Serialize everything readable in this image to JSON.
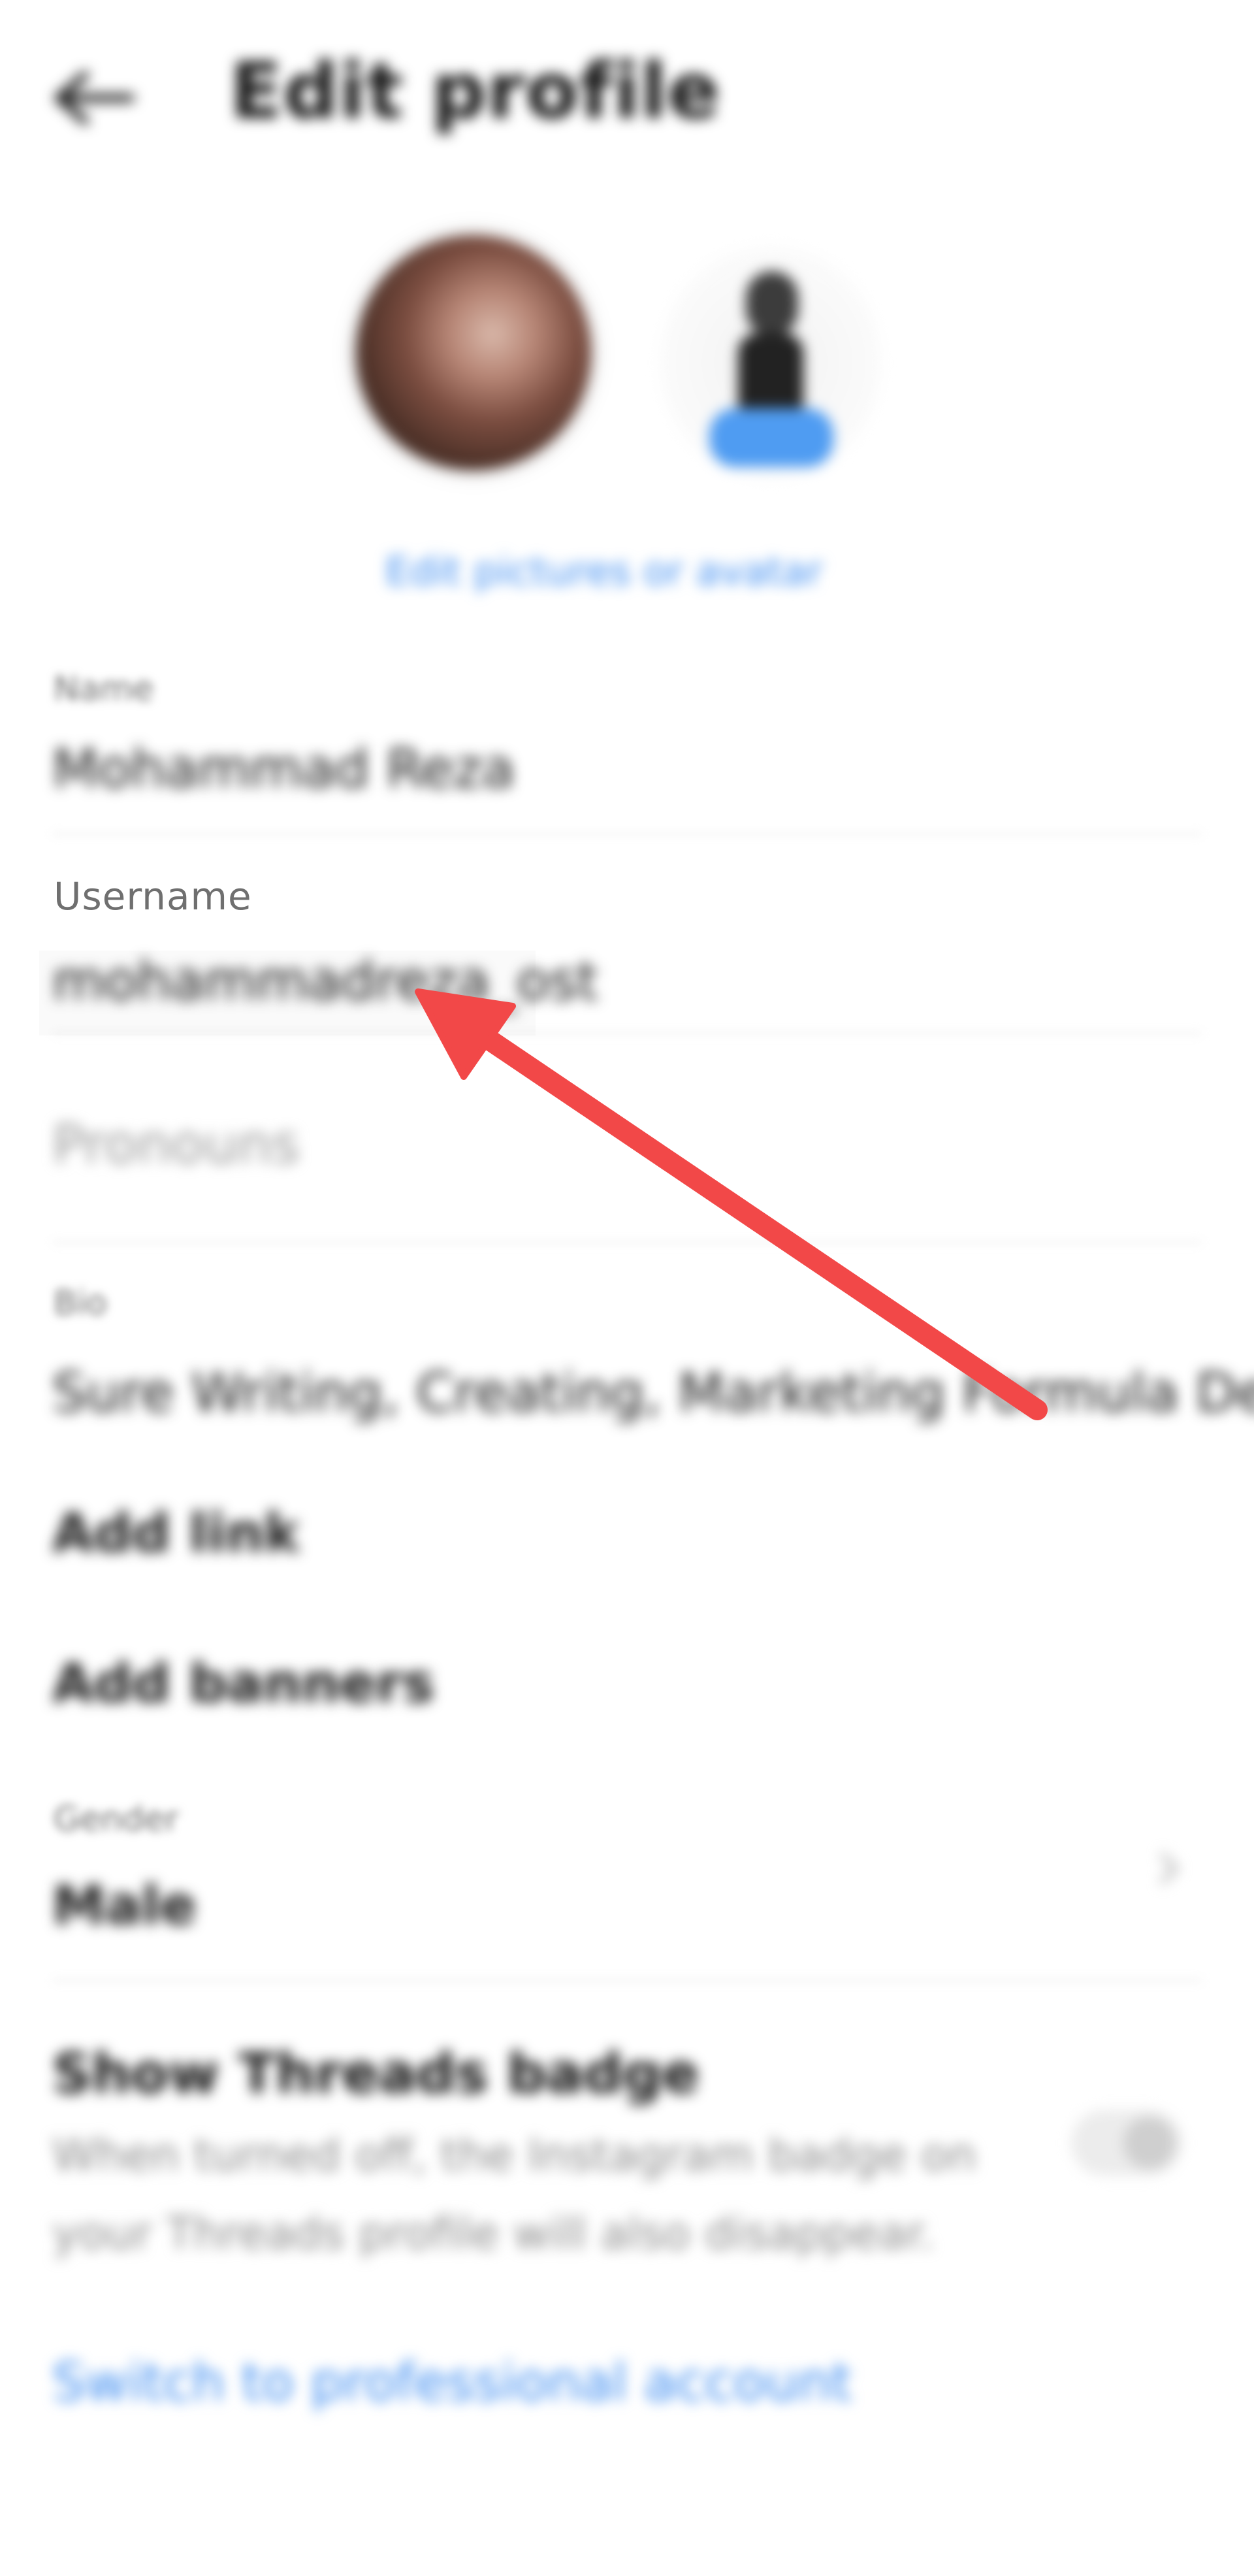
{
  "header": {
    "back_icon": "back-arrow-icon",
    "title": "Edit profile"
  },
  "avatars": {
    "edit_link": "Edit pictures or avatar"
  },
  "fields": {
    "name_label": "Name",
    "name_value": "Mohammad Reza",
    "username_label": "Username",
    "username_value": "mohammadreza_ost",
    "pronouns_placeholder": "Pronouns",
    "bio_label": "Bio",
    "bio_value": "Sure Writing, Creating, Marketing Formula Dev",
    "add_link": "Add link",
    "add_banners": "Add banners",
    "gender_label": "Gender",
    "gender_value": "Male"
  },
  "threads": {
    "title": "Show Threads badge",
    "description": "When turned off, the Instagram badge on your Threads profile will also disappear."
  },
  "footer": {
    "switch_link": "Switch to professional account"
  },
  "annotation": {
    "arrow_color": "#f24848"
  },
  "colors": {
    "link_blue": "#3d8cf0",
    "label_gray": "#6f6f6f"
  }
}
